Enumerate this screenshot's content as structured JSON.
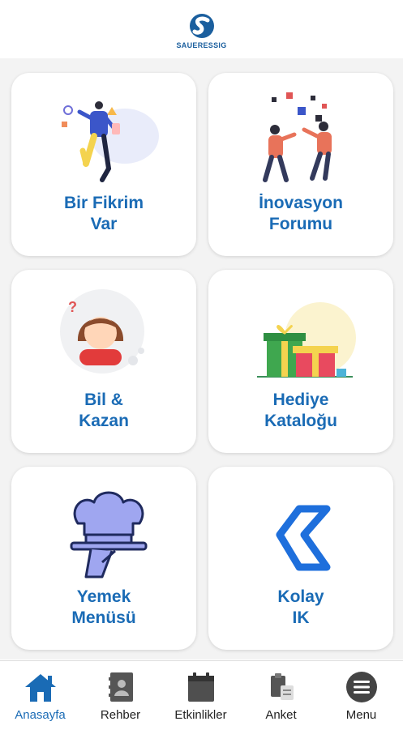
{
  "header": {
    "logo_text": "SAUERESSIG"
  },
  "tiles": [
    {
      "line1": "Bir Fikrim",
      "line2": "Var"
    },
    {
      "line1": "İnovasyon",
      "line2": "Forumu"
    },
    {
      "line1": "Bil &",
      "line2": "Kazan"
    },
    {
      "line1": "Hediye",
      "line2": "Kataloğu"
    },
    {
      "line1": "Yemek",
      "line2": "Menüsü"
    },
    {
      "line1": "Kolay",
      "line2": "IK"
    }
  ],
  "nav": [
    {
      "label": "Anasayfa",
      "icon": "home-icon",
      "active": true
    },
    {
      "label": "Rehber",
      "icon": "contacts-icon",
      "active": false
    },
    {
      "label": "Etkinlikler",
      "icon": "calendar-icon",
      "active": false
    },
    {
      "label": "Anket",
      "icon": "survey-icon",
      "active": false
    },
    {
      "label": "Menu",
      "icon": "menu-icon",
      "active": false
    }
  ],
  "colors": {
    "accent": "#1a6bb5",
    "tile_bg": "#ffffff",
    "grid_bg": "#f3f3f3"
  }
}
